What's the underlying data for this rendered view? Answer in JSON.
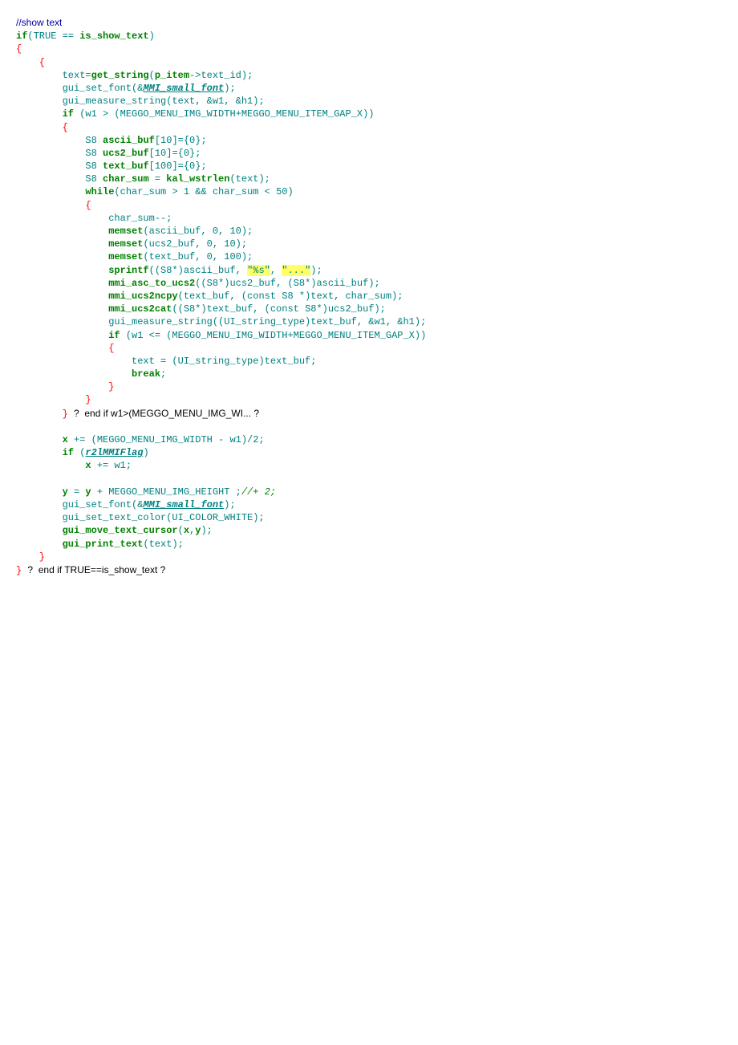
{
  "code": {
    "c01": "//show text",
    "c02a": "if",
    "c02b": "(TRUE == ",
    "c02c": "is_show_text",
    "c02d": ")",
    "c03": "{",
    "c04": "    {",
    "c05a": "        text=",
    "c05b": "get_string",
    "c05c": "(",
    "c05d": "p_item",
    "c05e": "->text_id);",
    "c06a": "        gui_set_font(&",
    "c06b": "MMI_small_font",
    "c06c": ");",
    "c07": "        gui_measure_string(text, &w1, &h1);",
    "c08a": "        ",
    "c08b": "if",
    "c08c": " (w1 > (MEGGO_MENU_IMG_WIDTH+MEGGO_MENU_ITEM_GAP_X))",
    "c09": "        {",
    "c10a": "            S8 ",
    "c10b": "ascii_buf",
    "c10c": "[10]={0};",
    "c11a": "            S8 ",
    "c11b": "ucs2_buf",
    "c11c": "[10]={0};",
    "c12a": "            S8 ",
    "c12b": "text_buf",
    "c12c": "[100]={0};",
    "c13a": "            S8 ",
    "c13b": "char_sum",
    "c13c": " = ",
    "c13d": "kal_wstrlen",
    "c13e": "(text);",
    "c14a": "            ",
    "c14b": "while",
    "c14c": "(char_sum > 1 && char_sum < 50)",
    "c15": "            {",
    "c16": "                char_sum--;",
    "c17a": "                ",
    "c17b": "memset",
    "c17c": "(ascii_buf, 0, 10);",
    "c18a": "                ",
    "c18b": "memset",
    "c18c": "(ucs2_buf, 0, 10);",
    "c19a": "                ",
    "c19b": "memset",
    "c19c": "(text_buf, 0, 100);",
    "c20a": "                ",
    "c20b": "sprintf",
    "c20c": "((S8*)ascii_buf, ",
    "c20d": "\"%s\"",
    "c20e": ", ",
    "c20f": "\"...\"",
    "c20g": ");",
    "c21a": "                ",
    "c21b": "mmi_asc_to_ucs2",
    "c21c": "((S8*)ucs2_buf, (S8*)ascii_buf);",
    "c22a": "                ",
    "c22b": "mmi_ucs2ncpy",
    "c22c": "(text_buf, (const S8 *)text, char_sum);",
    "c23a": "                ",
    "c23b": "mmi_ucs2cat",
    "c23c": "((S8*)text_buf, (const S8*)ucs2_buf);",
    "c24": "                gui_measure_string((UI_string_type)text_buf, &w1, &h1);",
    "c25a": "                ",
    "c25b": "if",
    "c25c": " (w1 <= (MEGGO_MENU_IMG_WIDTH+MEGGO_MENU_ITEM_GAP_X))",
    "c26": "                {",
    "c27": "                    text = (UI_string_type)text_buf;",
    "c28a": "                    ",
    "c28b": "break",
    "c28c": ";",
    "c29": "                }",
    "c30": "            }",
    "c31a": "        } ",
    "c31b": "?  end if w1>(MEGGO_MENU_IMG_WI... ?",
    "c32": "",
    "c33a": "        ",
    "c33b": "x",
    "c33c": " += (MEGGO_MENU_IMG_WIDTH - w1)/2;",
    "c34a": "        ",
    "c34b": "if",
    "c34c": " (",
    "c34d": "r2lMMIFlag",
    "c34e": ")",
    "c35a": "            ",
    "c35b": "x",
    "c35c": " += w1;",
    "c36": "",
    "c37a": "        ",
    "c37b": "y",
    "c37c": " = ",
    "c37d": "y",
    "c37e": " + MEGGO_MENU_IMG_HEIGHT ;",
    "c37f": "//+ 2;",
    "c38a": "        gui_set_font(&",
    "c38b": "MMI_small_font",
    "c38c": ");",
    "c39": "        gui_set_text_color(UI_COLOR_WHITE);",
    "c40a": "        ",
    "c40b": "gui_move_text_cursor",
    "c40c": "(",
    "c40d": "x",
    "c40e": ",",
    "c40f": "y",
    "c40g": ");",
    "c41a": "        ",
    "c41b": "gui_print_text",
    "c41c": "(text);",
    "c42": "    }",
    "c43a": "} ",
    "c43b": "?  end if TRUE==is_show_text ?"
  }
}
